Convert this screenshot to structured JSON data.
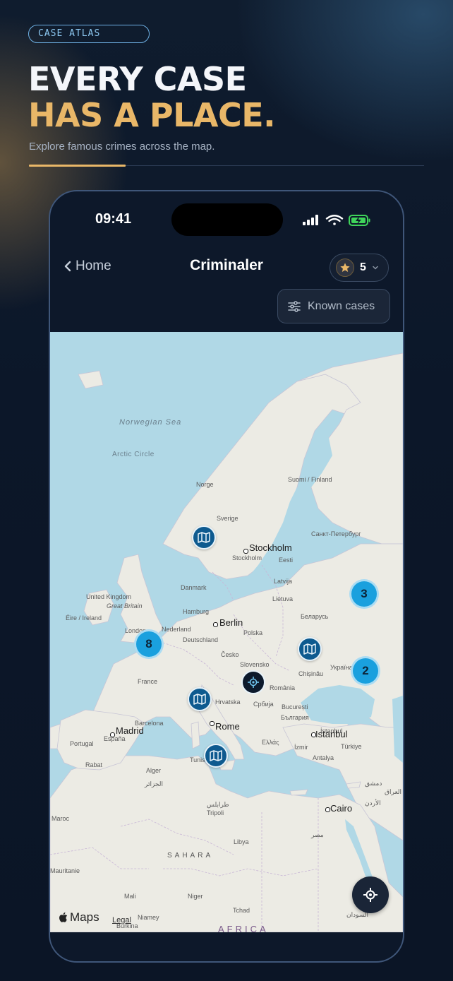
{
  "promo": {
    "tag": "CASE ATLAS",
    "headline_line1": "EVERY CASE",
    "headline_line2": "HAS A PLACE.",
    "subtitle": "Explore famous crimes across the map.",
    "accent_color": "#e9b768"
  },
  "status_bar": {
    "time": "09:41",
    "icons": [
      "signal-icon",
      "wifi-icon",
      "battery-charging-icon"
    ]
  },
  "nav": {
    "back_label": "Home",
    "title": "Criminaler",
    "score_value": "5",
    "filter_label": "Known cases"
  },
  "map": {
    "provider": "Maps",
    "legal_label": "Legal",
    "sea_labels": [
      "Norwegian Sea"
    ],
    "feature_labels": [
      "Arctic Circle",
      "SAHARA",
      "AFRICA"
    ],
    "cities": [
      "Stockholm",
      "Berlin",
      "Madrid",
      "Rome",
      "Istanbul",
      "Cairo"
    ],
    "small_labels": [
      "Norge",
      "Sverige",
      "Suomi / Finland",
      "Санкт-Петербург",
      "Stockholm",
      "Eesti",
      "Latvija",
      "Lietuva",
      "Danmark",
      "United Kingdom",
      "Great Britain",
      "Éire / Ireland",
      "Hamburg",
      "London",
      "Nederland",
      "Deutschland",
      "Polska",
      "Беларусь",
      "Česko",
      "Slovensko",
      "France",
      "Chișinău",
      "Україна",
      "Hrvatska",
      "Србија",
      "România",
      "București",
      "България",
      "Barcelona",
      "España",
      "Portugal",
      "İstanbul",
      "İzmir",
      "Türkiye",
      "Ελλάς",
      "Antalya",
      "Rabat",
      "Alger",
      "الجزائر",
      "Tunis",
      "طرابلس",
      "Tripoli",
      "Libya",
      "Maroc",
      "Mauritanie",
      "Mali",
      "Niger",
      "Tchad",
      "Niamey",
      "Burkina",
      "مصر",
      "السودان",
      "دمشق",
      "العراق",
      "الأردن"
    ],
    "clusters": [
      {
        "name": "uk-cluster",
        "count": "8"
      },
      {
        "name": "russia-cluster",
        "count": "3"
      },
      {
        "name": "ukraine-cluster",
        "count": "2"
      }
    ],
    "case_pins": [
      "norway-pin",
      "ukraine-pin",
      "italy-north-pin",
      "tunisia-pin"
    ],
    "colors": {
      "water": "#b0d8e6",
      "land": "#ecebe4",
      "pin": "#0e5a8f",
      "cluster": "#1aa0de"
    }
  }
}
